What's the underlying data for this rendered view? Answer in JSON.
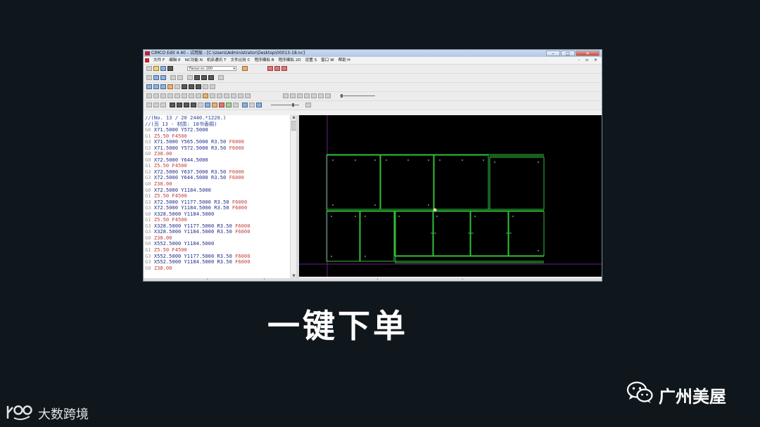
{
  "window": {
    "title": "CIMCO Edit 4.40 - 试用版 - [C:\\Users\\Administrator\\Desktop\\00013-18.nc]",
    "min_label": "‒",
    "max_label": "□",
    "close_label": "✕"
  },
  "menubar": {
    "items": [
      "文件 F",
      "编辑 E",
      "NC功能 N",
      "机床通讯 T",
      "文件比较 C",
      "程序模拟 B",
      "程序模拟 2D",
      "设置 S",
      "窗口 W",
      "帮助 H"
    ],
    "mdi_controls": "- ▫ ×"
  },
  "toolbar": {
    "machine_select": "Fanuc-cc 100",
    "icons": [
      "new-file-icon",
      "open-file-icon",
      "save-icon",
      "print-icon",
      "cut-icon",
      "copy-icon",
      "paste-icon",
      "find-icon",
      "replace-icon",
      "renumber-icon",
      "zoom-in-icon",
      "zoom-out-icon",
      "play-icon",
      "pause-icon",
      "stop-icon",
      "step-icon"
    ]
  },
  "editor": {
    "lines": [
      [
        {
          "t": "//(No. 13 / 20 2440.*1220.)",
          "c": "cmt"
        }
      ],
      [
        {
          "t": "//(页 13 - 材质: 18书香桐)",
          "c": "cmt"
        }
      ],
      [
        {
          "t": "G0 ",
          "c": "g"
        },
        {
          "t": "X71.5000 Y572.5000",
          "c": "xy"
        }
      ],
      [
        {
          "t": "G1 ",
          "c": "g"
        },
        {
          "t": "Z5.50 F4500",
          "c": "z"
        }
      ],
      [
        {
          "t": "G3 ",
          "c": "g"
        },
        {
          "t": "X71.5000 Y565.5000 R3.50 ",
          "c": "xy"
        },
        {
          "t": "F6000",
          "c": "f"
        }
      ],
      [
        {
          "t": "G3 ",
          "c": "g"
        },
        {
          "t": "X71.5000 Y572.5000 R3.50 ",
          "c": "xy"
        },
        {
          "t": "F6000",
          "c": "f"
        }
      ],
      [
        {
          "t": "G0 ",
          "c": "g"
        },
        {
          "t": "Z38.00",
          "c": "z"
        }
      ],
      [
        {
          "t": "G0 ",
          "c": "g"
        },
        {
          "t": "X72.5000 Y644.5000",
          "c": "xy"
        }
      ],
      [
        {
          "t": "G1 ",
          "c": "g"
        },
        {
          "t": "Z5.50 F4500",
          "c": "z"
        }
      ],
      [
        {
          "t": "G3 ",
          "c": "g"
        },
        {
          "t": "X72.5000 Y637.5000 R3.50 ",
          "c": "xy"
        },
        {
          "t": "F6000",
          "c": "f"
        }
      ],
      [
        {
          "t": "G3 ",
          "c": "g"
        },
        {
          "t": "X72.5000 Y644.5000 R3.50 ",
          "c": "xy"
        },
        {
          "t": "F6000",
          "c": "f"
        }
      ],
      [
        {
          "t": "G0 ",
          "c": "g"
        },
        {
          "t": "Z38.00",
          "c": "z"
        }
      ],
      [
        {
          "t": "G0 ",
          "c": "g"
        },
        {
          "t": "X72.5000 Y1184.5000",
          "c": "xy"
        }
      ],
      [
        {
          "t": "G1 ",
          "c": "g"
        },
        {
          "t": "Z5.50 F4500",
          "c": "z"
        }
      ],
      [
        {
          "t": "G3 ",
          "c": "g"
        },
        {
          "t": "X72.5000 Y1177.5000 R3.50 ",
          "c": "xy"
        },
        {
          "t": "F6000",
          "c": "f"
        }
      ],
      [
        {
          "t": "G3 ",
          "c": "g"
        },
        {
          "t": "X72.5000 Y1184.5000 R3.50 ",
          "c": "xy"
        },
        {
          "t": "F6000",
          "c": "f"
        }
      ],
      [
        {
          "t": "G0 ",
          "c": "g"
        },
        {
          "t": "X328.5000 Y1184.5000",
          "c": "xy"
        }
      ],
      [
        {
          "t": "G1 ",
          "c": "g"
        },
        {
          "t": "Z5.50 F4500",
          "c": "z"
        }
      ],
      [
        {
          "t": "G3 ",
          "c": "g"
        },
        {
          "t": "X328.5000 Y1177.5000 R3.50 ",
          "c": "xy"
        },
        {
          "t": "F6000",
          "c": "f"
        }
      ],
      [
        {
          "t": "G3 ",
          "c": "g"
        },
        {
          "t": "X328.5000 Y1184.5000 R3.50 ",
          "c": "xy"
        },
        {
          "t": "F6000",
          "c": "f"
        }
      ],
      [
        {
          "t": "G0 ",
          "c": "g"
        },
        {
          "t": "Z38.00",
          "c": "z"
        }
      ],
      [
        {
          "t": "G0 ",
          "c": "g"
        },
        {
          "t": "X552.5000 Y1184.5000",
          "c": "xy"
        }
      ],
      [
        {
          "t": "G1 ",
          "c": "g"
        },
        {
          "t": "Z5.50 F4500",
          "c": "z"
        }
      ],
      [
        {
          "t": "G3 ",
          "c": "g"
        },
        {
          "t": "X552.5000 Y1177.5000 R3.50 ",
          "c": "xy"
        },
        {
          "t": "F6000",
          "c": "f"
        }
      ],
      [
        {
          "t": "G3 ",
          "c": "g"
        },
        {
          "t": "X552.5000 Y1184.5000 R3.50 ",
          "c": "xy"
        },
        {
          "t": "F6000",
          "c": "f"
        }
      ],
      [
        {
          "t": "G0 ",
          "c": "g"
        },
        {
          "t": "Z38.00",
          "c": "z"
        }
      ]
    ]
  },
  "viewport": {
    "background": "#000000",
    "panel_color": "#2fbf3a",
    "axis_color": "#7a2a9a",
    "cursor_color": "#d8d8a0"
  },
  "caption": "一键下单",
  "brand_right": "广州美屋",
  "brand_left": "大数跨境",
  "colors": {
    "page_bg": "#10171c",
    "caption": "#ffffff"
  }
}
